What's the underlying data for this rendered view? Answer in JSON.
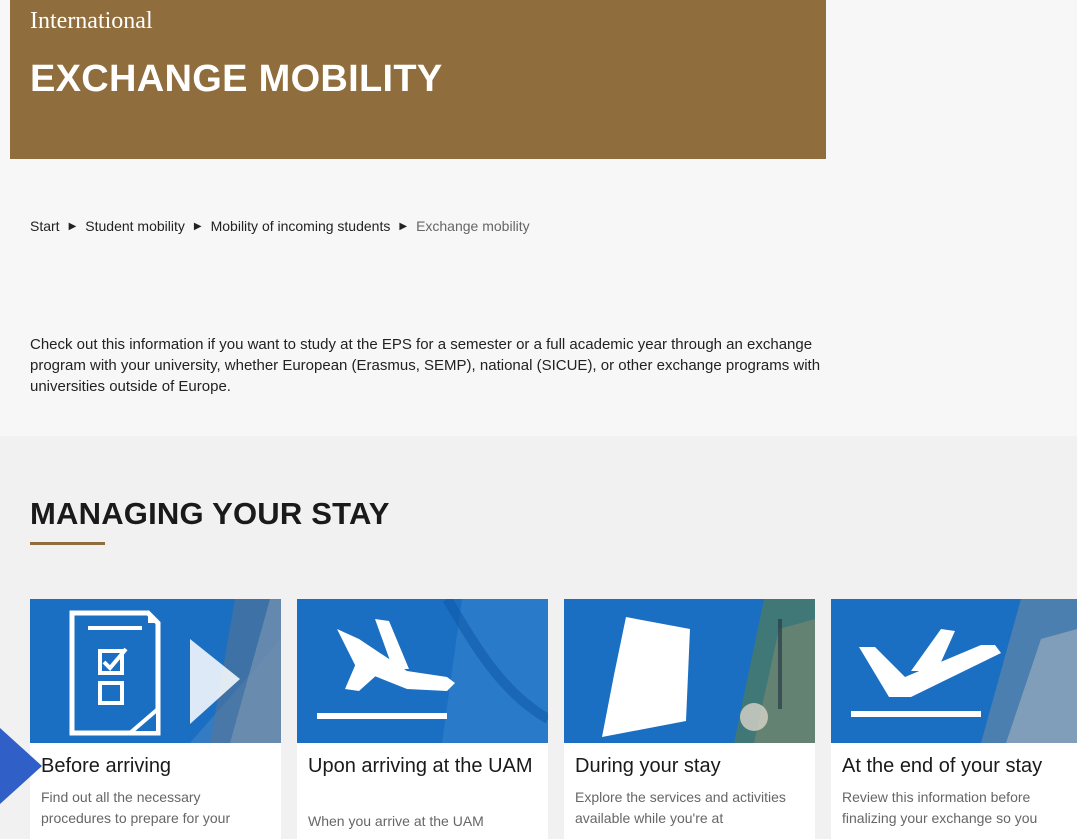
{
  "hero": {
    "supertitle": "International",
    "title": "EXCHANGE MOBILITY",
    "background_color": "#8f6d3d"
  },
  "breadcrumb": {
    "items": [
      "Start",
      "Student mobility",
      "Mobility of incoming students"
    ],
    "current": "Exchange mobility",
    "separator": "▶"
  },
  "intro": {
    "text": "Check out this information if you want to study at the EPS for a semester or a full academic year through an exchange program with your university, whether European (Erasmus, SEMP), national (SICUE), or other exchange programs with universities outside of Europe."
  },
  "section": {
    "title": "MANAGING YOUR STAY",
    "accent_color": "#8f6d3d"
  },
  "cards": [
    {
      "title": "Before arriving",
      "description": "Find out all the necessary procedures to prepare for your",
      "icon": "checklist-document-icon"
    },
    {
      "title": "Upon arriving at the UAM",
      "description": "When you arrive at the UAM",
      "icon": "plane-landing-icon"
    },
    {
      "title": "During your stay",
      "description": "Explore the services and activities available while you're at",
      "icon": "map-shape-icon"
    },
    {
      "title": "At the end of your stay",
      "description": "Review this information before finalizing your exchange so you",
      "icon": "plane-takeoff-icon"
    }
  ],
  "colors": {
    "card_blue": "#1b6fc2",
    "pointer_blue": "#2f5fc7"
  }
}
